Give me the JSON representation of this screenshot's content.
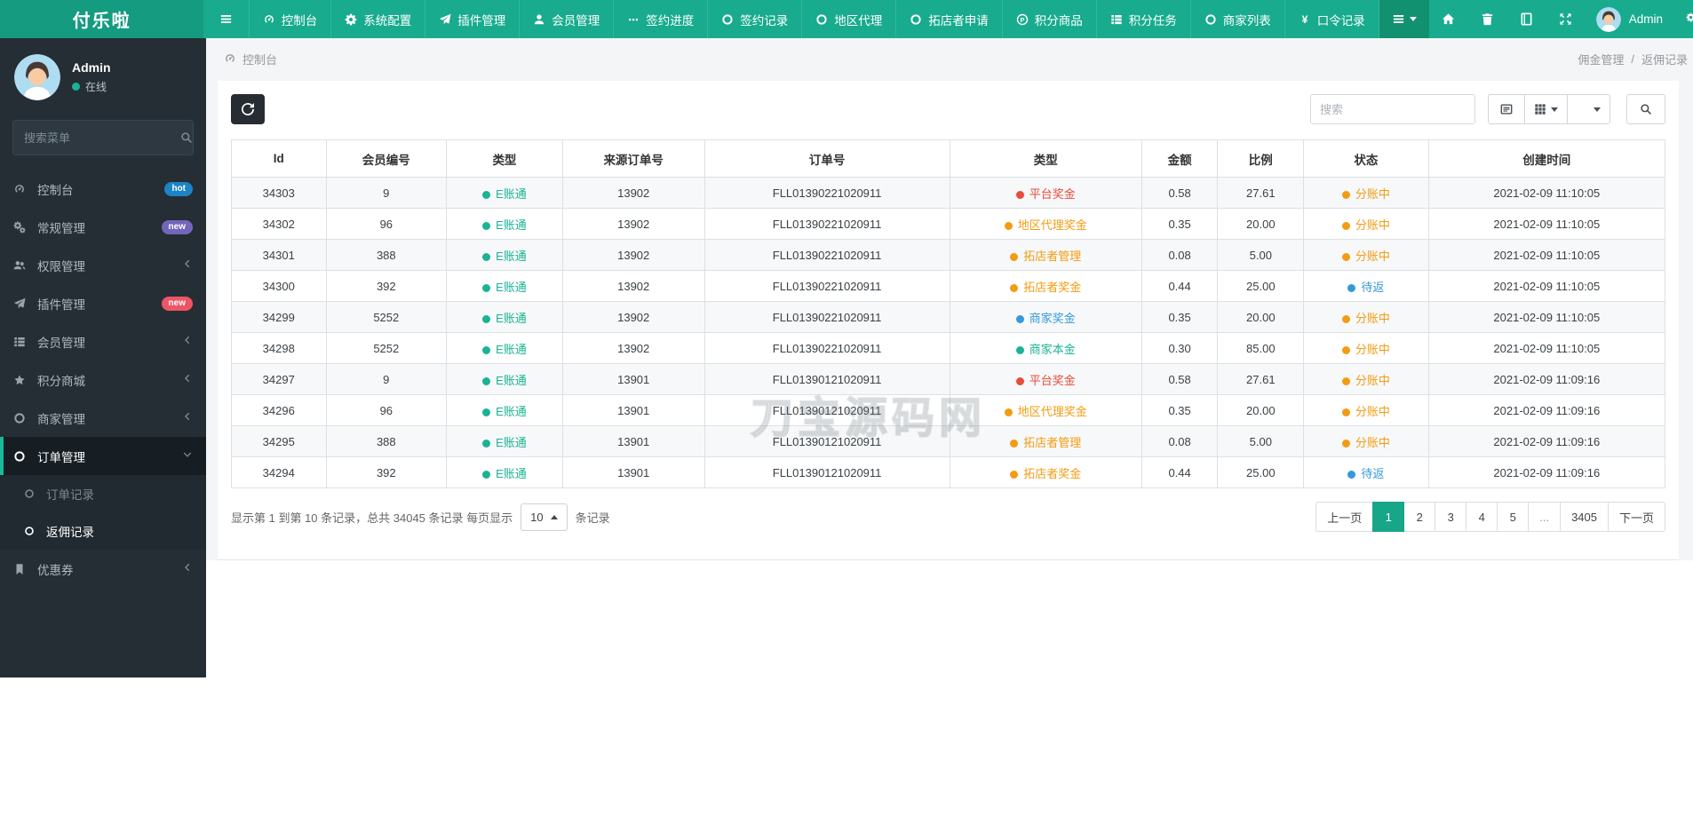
{
  "navbar": {
    "brand": "付乐啦",
    "items": [
      {
        "label": "控制台",
        "icon": "gauge"
      },
      {
        "label": "系统配置",
        "icon": "gear"
      },
      {
        "label": "插件管理",
        "icon": "plane"
      },
      {
        "label": "会员管理",
        "icon": "user"
      },
      {
        "label": "签约进度",
        "icon": "ellipsis"
      },
      {
        "label": "签约记录",
        "icon": "circle"
      },
      {
        "label": "地区代理",
        "icon": "circle"
      },
      {
        "label": "拓店者申请",
        "icon": "circle"
      },
      {
        "label": "积分商品",
        "icon": "pcircle"
      },
      {
        "label": "积分任务",
        "icon": "tasks"
      },
      {
        "label": "商家列表",
        "icon": "circle"
      },
      {
        "label": "口令记录",
        "icon": "yen"
      }
    ],
    "right_icons": [
      {
        "name": "home"
      },
      {
        "name": "trash"
      },
      {
        "name": "book"
      },
      {
        "name": "expand"
      }
    ],
    "user": {
      "name": "Admin"
    }
  },
  "sidebar": {
    "user": {
      "name": "Admin",
      "status": "在线"
    },
    "search_placeholder": "搜索菜单",
    "items": [
      {
        "label": "控制台",
        "icon": "gauge",
        "badge": {
          "text": "hot",
          "color": "#1C84C6"
        }
      },
      {
        "label": "常规管理",
        "icon": "gears",
        "badge": {
          "text": "new",
          "color": "#7266BA"
        }
      },
      {
        "label": "权限管理",
        "icon": "users",
        "collapsible": true
      },
      {
        "label": "插件管理",
        "icon": "plane",
        "badge": {
          "text": "new",
          "color": "#ED5565"
        }
      },
      {
        "label": "会员管理",
        "icon": "tasks",
        "collapsible": true
      },
      {
        "label": "积分商城",
        "icon": "star",
        "collapsible": true
      },
      {
        "label": "商家管理",
        "icon": "circle",
        "collapsible": true
      },
      {
        "label": "订单管理",
        "icon": "circle",
        "expanded": true,
        "active": true,
        "children": [
          {
            "label": "订单记录",
            "active": false
          },
          {
            "label": "返佣记录",
            "active": true
          }
        ]
      },
      {
        "label": "优惠券",
        "icon": "bookmark",
        "collapsible": true
      }
    ]
  },
  "breadcrumb": {
    "left": "控制台",
    "group": "佣金管理",
    "separator": "/",
    "page": "返佣记录"
  },
  "toolbar": {
    "search_placeholder": "搜索"
  },
  "table": {
    "columns": [
      "Id",
      "会员编号",
      "类型",
      "来源订单号",
      "订单号",
      "类型",
      "金额",
      "比例",
      "状态",
      "创建时间"
    ],
    "rows": [
      {
        "id": "34303",
        "member": "9",
        "etype": {
          "label": "E账通",
          "color": "#1AB394"
        },
        "source": "13902",
        "order_no": "FLL01390221020911",
        "award": {
          "label": "平台奖金",
          "color": "#E74C3C"
        },
        "amount": "0.58",
        "ratio": "27.61",
        "status": {
          "label": "分账中",
          "color": "#F39C12"
        },
        "created": "2021-02-09 11:10:05"
      },
      {
        "id": "34302",
        "member": "96",
        "etype": {
          "label": "E账通",
          "color": "#1AB394"
        },
        "source": "13902",
        "order_no": "FLL01390221020911",
        "award": {
          "label": "地区代理奖金",
          "color": "#F39C12"
        },
        "amount": "0.35",
        "ratio": "20.00",
        "status": {
          "label": "分账中",
          "color": "#F39C12"
        },
        "created": "2021-02-09 11:10:05"
      },
      {
        "id": "34301",
        "member": "388",
        "etype": {
          "label": "E账通",
          "color": "#1AB394"
        },
        "source": "13902",
        "order_no": "FLL01390221020911",
        "award": {
          "label": "拓店者管理",
          "color": "#F39C12"
        },
        "amount": "0.08",
        "ratio": "5.00",
        "status": {
          "label": "分账中",
          "color": "#F39C12"
        },
        "created": "2021-02-09 11:10:05"
      },
      {
        "id": "34300",
        "member": "392",
        "etype": {
          "label": "E账通",
          "color": "#1AB394"
        },
        "source": "13902",
        "order_no": "FLL01390221020911",
        "award": {
          "label": "拓店者奖金",
          "color": "#F39C12"
        },
        "amount": "0.44",
        "ratio": "25.00",
        "status": {
          "label": "待返",
          "color": "#3498DB"
        },
        "created": "2021-02-09 11:10:05"
      },
      {
        "id": "34299",
        "member": "5252",
        "etype": {
          "label": "E账通",
          "color": "#1AB394"
        },
        "source": "13902",
        "order_no": "FLL01390221020911",
        "award": {
          "label": "商家奖金",
          "color": "#3498DB"
        },
        "amount": "0.35",
        "ratio": "20.00",
        "status": {
          "label": "分账中",
          "color": "#F39C12"
        },
        "created": "2021-02-09 11:10:05"
      },
      {
        "id": "34298",
        "member": "5252",
        "etype": {
          "label": "E账通",
          "color": "#1AB394"
        },
        "source": "13902",
        "order_no": "FLL01390221020911",
        "award": {
          "label": "商家本金",
          "color": "#1AB394"
        },
        "amount": "0.30",
        "ratio": "85.00",
        "status": {
          "label": "分账中",
          "color": "#F39C12"
        },
        "created": "2021-02-09 11:10:05"
      },
      {
        "id": "34297",
        "member": "9",
        "etype": {
          "label": "E账通",
          "color": "#1AB394"
        },
        "source": "13901",
        "order_no": "FLL01390121020911",
        "award": {
          "label": "平台奖金",
          "color": "#E74C3C"
        },
        "amount": "0.58",
        "ratio": "27.61",
        "status": {
          "label": "分账中",
          "color": "#F39C12"
        },
        "created": "2021-02-09 11:09:16"
      },
      {
        "id": "34296",
        "member": "96",
        "etype": {
          "label": "E账通",
          "color": "#1AB394"
        },
        "source": "13901",
        "order_no": "FLL01390121020911",
        "award": {
          "label": "地区代理奖金",
          "color": "#F39C12"
        },
        "amount": "0.35",
        "ratio": "20.00",
        "status": {
          "label": "分账中",
          "color": "#F39C12"
        },
        "created": "2021-02-09 11:09:16"
      },
      {
        "id": "34295",
        "member": "388",
        "etype": {
          "label": "E账通",
          "color": "#1AB394"
        },
        "source": "13901",
        "order_no": "FLL01390121020911",
        "award": {
          "label": "拓店者管理",
          "color": "#F39C12"
        },
        "amount": "0.08",
        "ratio": "5.00",
        "status": {
          "label": "分账中",
          "color": "#F39C12"
        },
        "created": "2021-02-09 11:09:16"
      },
      {
        "id": "34294",
        "member": "392",
        "etype": {
          "label": "E账通",
          "color": "#1AB394"
        },
        "source": "13901",
        "order_no": "FLL01390121020911",
        "award": {
          "label": "拓店者奖金",
          "color": "#F39C12"
        },
        "amount": "0.44",
        "ratio": "25.00",
        "status": {
          "label": "待返",
          "color": "#3498DB"
        },
        "created": "2021-02-09 11:09:16"
      }
    ]
  },
  "footer": {
    "summary_prefix": "显示第 1 到第 10 条记录，总共 34045 条记录 每页显示",
    "page_size": "10",
    "summary_suffix": "条记录",
    "pagination": {
      "prev": "上一页",
      "next": "下一页",
      "pages": [
        "1",
        "2",
        "3",
        "4",
        "5",
        "...",
        "3405"
      ],
      "active": "1"
    }
  },
  "watermark": "刀宝源码网",
  "colors": {
    "navbar": "#18AB8E",
    "brand_bg": "#149B80",
    "accent": "#18BC9C",
    "sidebar_bg": "#252E35",
    "active_page_bg": "#18A689"
  }
}
